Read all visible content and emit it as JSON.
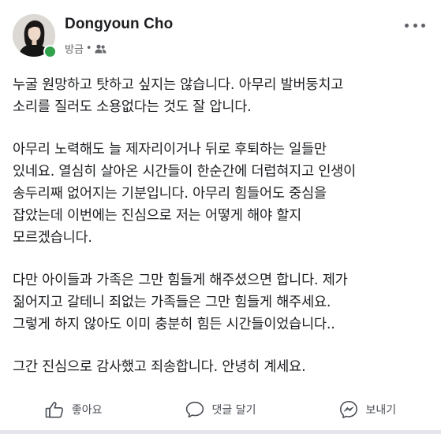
{
  "post": {
    "author": {
      "name": "Dongyoun Cho",
      "online": true,
      "status_color": "#31a24c"
    },
    "timestamp": "방금",
    "separator": "•",
    "audience_icon": "friends-icon",
    "more_icon": "more-horizontal-icon",
    "paragraphs": [
      "누굴 원망하고 탓하고 싶지는 않습니다. 아무리 발버둥치고\n소리를 질러도 소용없다는 것도 잘 압니다.",
      "아무리 노력해도 늘 제자리이거나 뒤로 후퇴하는 일들만\n있네요. 열심히 살아온 시간들이 한순간에 더럽혀지고 인생이\n송두리째 없어지는 기분입니다. 아무리 힘들어도 중심을\n잡았는데 이번에는 진심으로 저는 어떻게 해야 할지\n모르겠습니다.",
      "다만 아이들과 가족은 그만 힘들게 해주셨으면 합니다. 제가\n짊어지고 갈테니 죄없는 가족들은 그만 힘들게 해주세요.\n그렇게 하지 않아도 이미 충분히 힘든 시간들이었습니다..",
      "그간 진심으로 감사했고 죄송합니다. 안녕히 계세요."
    ]
  },
  "actions": {
    "like": {
      "label": "좋아요",
      "icon": "thumbs-up-icon"
    },
    "comment": {
      "label": "댓글 달기",
      "icon": "comment-icon"
    },
    "share": {
      "label": "보내기",
      "icon": "messenger-icon"
    }
  }
}
